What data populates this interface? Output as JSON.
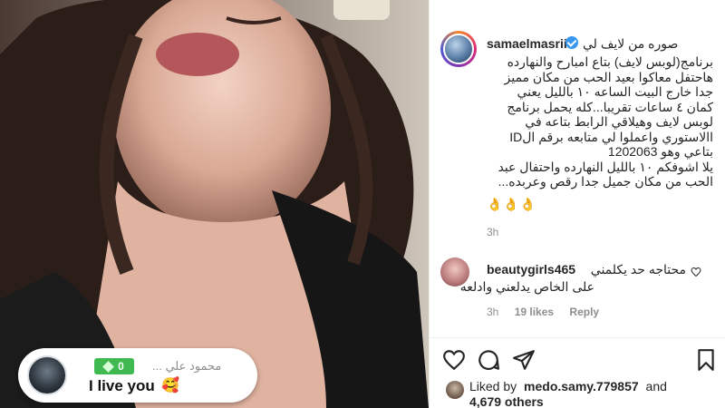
{
  "photo": {
    "sticker_text": "",
    "live_comment": {
      "name": "محمود علي ...",
      "badge_value": "0",
      "text": "I live you",
      "emoji": "🥰"
    }
  },
  "post": {
    "username": "samaelmasrii",
    "verified": true,
    "caption_first": "صوره من لايف لي",
    "caption_lines": [
      "برنامج(لوبس لايف) بتاع امبارح والنهارده",
      "هاحتفل معاكوا بعيد الحب من مكان مميز",
      "جدا خارج البيت الساعه ١٠ بالليل يعني",
      "كمان ٤ ساعات تقريبا...كله يحمل برنامج",
      "لوبس لايف وهيلاقي الرابط بتاعه في",
      "االاستوري واعملوا لي متابعه برقم الID",
      "بتاعي وهو 1202063",
      "يلا اشوفكم ١٠ بالليل النهارده واحتفال عبد",
      "الحب من مكان جميل جدا رقص وعربده..."
    ],
    "caption_emoji": "👌👌👌",
    "time": "3h"
  },
  "comment": {
    "username": "beautygirls465",
    "text_line1": "محتاجه حد يكلمني",
    "text_line2": "على الخاص يدلعني وادلعه",
    "time": "3h",
    "likes": "19 likes",
    "reply": "Reply"
  },
  "actions": {
    "liked_by_prefix": "Liked by",
    "liked_by_user": "medo.samy.779857",
    "liked_by_and": "and",
    "others": "4,679 others"
  },
  "colors": {
    "accent_blue": "#3897f0",
    "badge_green": "#3fb950",
    "muted_text": "#8e8e8e"
  }
}
